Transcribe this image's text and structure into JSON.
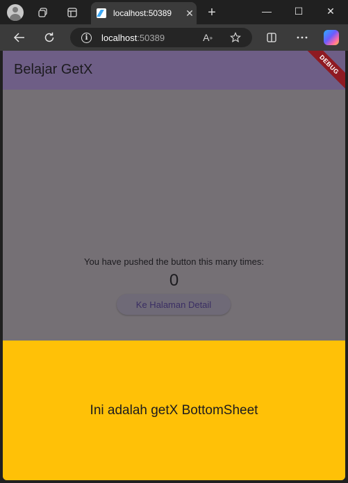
{
  "browser": {
    "tab": {
      "title": "localhost:50389",
      "close": "✕"
    },
    "new_tab": "+",
    "window": {
      "minimize": "—",
      "maximize": "☐",
      "close": "✕"
    },
    "address": {
      "host": "localhost",
      "port": ":50389"
    }
  },
  "app": {
    "title": "Belajar GetX",
    "debug_banner": "DEBUG",
    "counter_label": "You have pushed the button this many times:",
    "counter_value": "0",
    "detail_button": "Ke Halaman Detail",
    "bottom_sheet_text": "Ini adalah getX BottomSheet"
  },
  "colors": {
    "appbar": "#6e5e86",
    "scrim_background": "#757075",
    "bottom_sheet": "#ffc107",
    "debug_banner": "#8f1a22"
  }
}
